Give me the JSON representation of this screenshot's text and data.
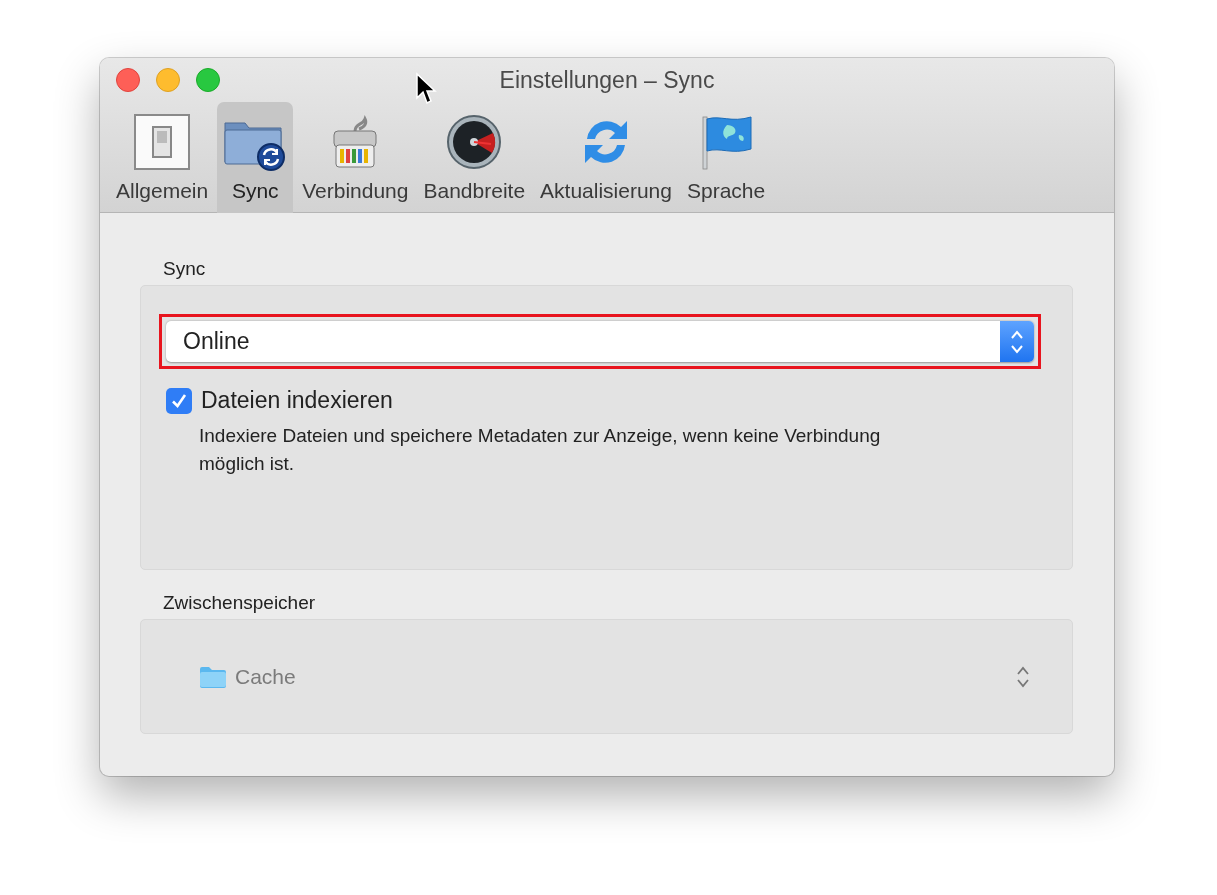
{
  "window": {
    "title": "Einstellungen – Sync"
  },
  "toolbar": [
    {
      "label": "Allgemein",
      "kind": "switch",
      "selected": false
    },
    {
      "label": "Sync",
      "kind": "folder-sync",
      "selected": true
    },
    {
      "label": "Verbindung",
      "kind": "cable",
      "selected": false
    },
    {
      "label": "Bandbreite",
      "kind": "gauge",
      "selected": false
    },
    {
      "label": "Aktualisierung",
      "kind": "sync",
      "selected": false
    },
    {
      "label": "Sprache",
      "kind": "flag",
      "selected": false
    }
  ],
  "sections": [
    {
      "title": "Sync",
      "popup": {
        "value": "Online",
        "highlighted": true
      },
      "checkbox": {
        "label": "Dateien indexieren",
        "checked": true
      },
      "description": "Indexiere Dateien und speichere Metadaten zur Anzeige, wenn keine Verbindung möglich ist."
    },
    {
      "title": "Zwischenspeicher",
      "folder_popup": {
        "value": "Cache",
        "disabled": true
      }
    }
  ]
}
